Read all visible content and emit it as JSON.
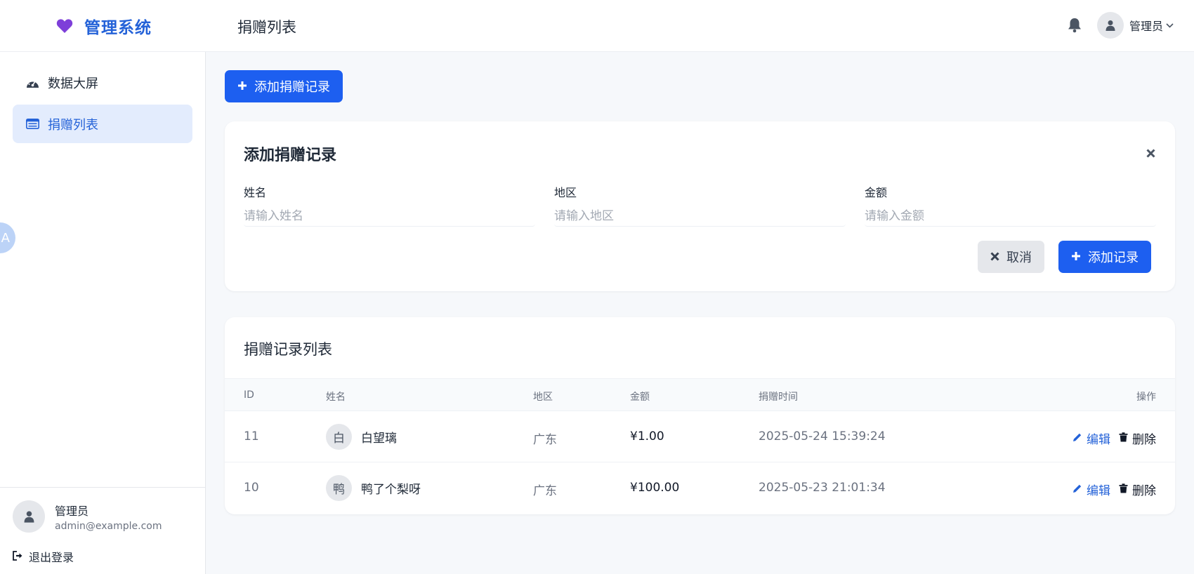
{
  "brand": {
    "name": "管理系统",
    "accent": "#2462d8",
    "heart_color": "#7e3fd9"
  },
  "header": {
    "page_title": "捐赠列表",
    "user_name": "管理员"
  },
  "sidebar": {
    "items": [
      {
        "label": "数据大屏",
        "icon": "dashboard-icon",
        "active": false
      },
      {
        "label": "捐赠列表",
        "icon": "list-icon",
        "active": true
      }
    ],
    "floating_badge": "A",
    "footer": {
      "user_name": "管理员",
      "email": "admin@example.com",
      "logout_label": "退出登录"
    }
  },
  "main": {
    "add_button_label": "添加捐赠记录",
    "form": {
      "title": "添加捐赠记录",
      "fields": [
        {
          "label": "姓名",
          "value": "",
          "placeholder": "请输入姓名"
        },
        {
          "label": "地区",
          "value": "",
          "placeholder": "请输入地区"
        },
        {
          "label": "金额",
          "value": "",
          "placeholder": "请输入金额"
        }
      ],
      "cancel_label": "取消",
      "submit_label": "添加记录"
    },
    "list": {
      "title": "捐赠记录列表",
      "columns": [
        "ID",
        "姓名",
        "地区",
        "金额",
        "捐赠时间",
        "操作"
      ],
      "rows": [
        {
          "id": "11",
          "initial": "白",
          "name": "白望璃",
          "region": "广东",
          "amount": "¥1.00",
          "time": "2025-05-24 15:39:24",
          "edit": "编辑",
          "delete": "删除"
        },
        {
          "id": "10",
          "initial": "鸭",
          "name": "鸭了个梨呀",
          "region": "广东",
          "amount": "¥100.00",
          "time": "2025-05-23 21:01:34",
          "edit": "编辑",
          "delete": "删除"
        }
      ]
    }
  }
}
